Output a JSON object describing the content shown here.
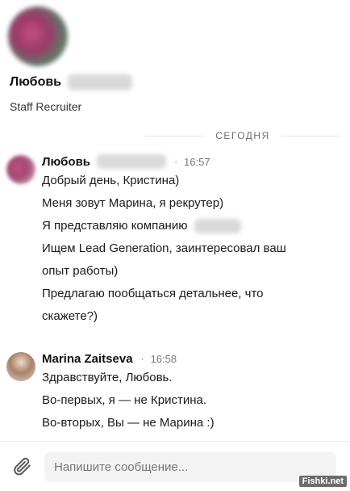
{
  "profile": {
    "name": "Любовь",
    "title": "Staff Recruiter"
  },
  "divider": {
    "label": "СЕГОДНЯ"
  },
  "messages": [
    {
      "sender": "Любовь",
      "dot": "·",
      "time": "16:57",
      "lines": [
        "Добрый день, Кристина)",
        "Меня зовут Марина, я рекрутер)",
        "Я представляю компанию",
        "Ищем Lead Generation, заинтересовал ваш",
        "опыт работы)",
        "Предлагаю пообщаться детальнее, что",
        "скажете?)"
      ]
    },
    {
      "sender": "Marina Zaitseva",
      "dot": "·",
      "time": "16:58",
      "lines": [
        "Здравствуйте, Любовь.",
        "Во-первых, я — не Кристина.",
        "Во-вторых, Вы — не Марина :)"
      ]
    }
  ],
  "composer": {
    "placeholder": "Напишите сообщение..."
  },
  "icons": {
    "attach": "paperclip-icon"
  },
  "watermark": "Fishki.net"
}
